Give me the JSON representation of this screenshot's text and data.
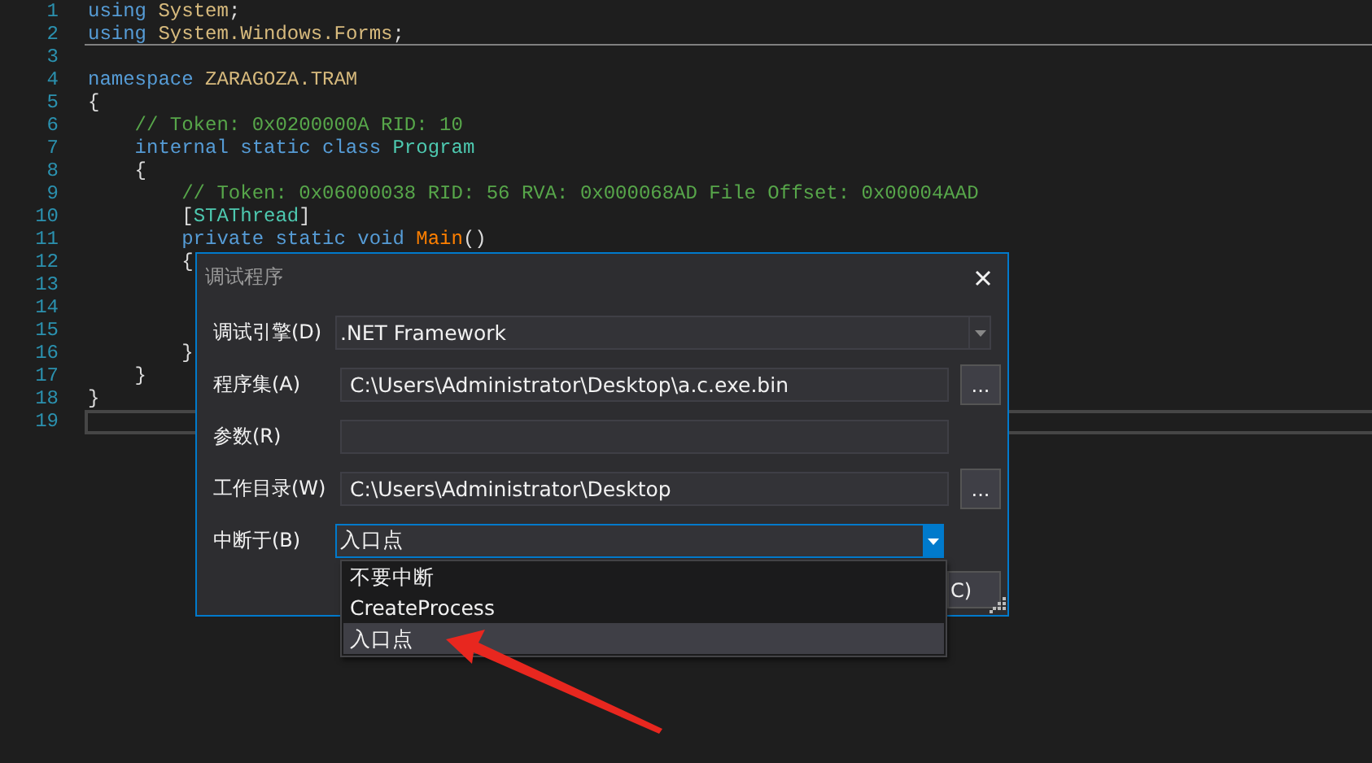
{
  "editor": {
    "lines": [
      {
        "number": "1",
        "current": false,
        "underlined": false,
        "tokens": [
          {
            "kind": "keyword",
            "text": "using "
          },
          {
            "kind": "namespace",
            "text": "System"
          },
          {
            "kind": "plain",
            "text": ";"
          }
        ]
      },
      {
        "number": "2",
        "current": false,
        "underlined": true,
        "tokens": [
          {
            "kind": "keyword",
            "text": "using "
          },
          {
            "kind": "namespace",
            "text": "System.Windows.Forms"
          },
          {
            "kind": "plain",
            "text": ";"
          }
        ]
      },
      {
        "number": "3",
        "current": false,
        "underlined": false
      },
      {
        "number": "4",
        "current": false,
        "underlined": false,
        "tokens": [
          {
            "kind": "keyword",
            "text": "namespace "
          },
          {
            "kind": "namespace",
            "text": "ZARAGOZA.TRAM"
          }
        ]
      },
      {
        "number": "5",
        "current": false,
        "underlined": false,
        "tokens": [
          {
            "kind": "plain",
            "text": "{"
          }
        ]
      },
      {
        "number": "6",
        "current": false,
        "underlined": false,
        "tokens": [
          {
            "kind": "comment",
            "text": "    // Token: 0x0200000A RID: 10"
          }
        ]
      },
      {
        "number": "7",
        "current": false,
        "underlined": false,
        "tokens": [
          {
            "kind": "keyword",
            "text": "    internal static class "
          },
          {
            "kind": "type",
            "text": "Program"
          }
        ]
      },
      {
        "number": "8",
        "current": false,
        "underlined": false,
        "tokens": [
          {
            "kind": "plain",
            "text": "    {"
          }
        ]
      },
      {
        "number": "9",
        "current": false,
        "underlined": false,
        "tokens": [
          {
            "kind": "comment",
            "text": "        // Token: 0x06000038 RID: 56 RVA: 0x000068AD File Offset: 0x00004AAD"
          }
        ]
      },
      {
        "number": "10",
        "current": false,
        "underlined": false,
        "tokens": [
          {
            "kind": "plain",
            "text": "        ["
          },
          {
            "kind": "type",
            "text": "STAThread"
          },
          {
            "kind": "plain",
            "text": "]"
          }
        ]
      },
      {
        "number": "11",
        "current": false,
        "underlined": false,
        "tokens": [
          {
            "kind": "keyword",
            "text": "        private static void "
          },
          {
            "kind": "method",
            "text": "Main"
          },
          {
            "kind": "plain",
            "text": "()"
          }
        ]
      },
      {
        "number": "12",
        "current": false,
        "underlined": false,
        "tokens": [
          {
            "kind": "plain",
            "text": "        {"
          }
        ]
      },
      {
        "number": "13",
        "current": false,
        "underlined": false
      },
      {
        "number": "14",
        "current": false,
        "underlined": false
      },
      {
        "number": "15",
        "current": false,
        "underlined": false
      },
      {
        "number": "16",
        "current": false,
        "underlined": false,
        "tokens": [
          {
            "kind": "plain",
            "text": "        }"
          }
        ]
      },
      {
        "number": "17",
        "current": false,
        "underlined": false,
        "tokens": [
          {
            "kind": "plain",
            "text": "    }"
          }
        ]
      },
      {
        "number": "18",
        "current": false,
        "underlined": false,
        "tokens": [
          {
            "kind": "plain",
            "text": "}"
          }
        ]
      },
      {
        "number": "19",
        "current": true,
        "underlined": false
      }
    ]
  },
  "dialog": {
    "title": "调试程序",
    "fields": [
      {
        "kind": "combo",
        "label": "调试引擎(D)",
        "value": ".NET Framework",
        "focused": false
      },
      {
        "kind": "text",
        "label": "程序集(A)",
        "value": "C:\\Users\\Administrator\\Desktop\\a.c.exe.bin",
        "browse_button": "..."
      },
      {
        "kind": "text",
        "label": "参数(R)"
      },
      {
        "kind": "text",
        "label": "工作目录(W)",
        "value": "C:\\Users\\Administrator\\Desktop",
        "browse_button": "..."
      },
      {
        "kind": "combo",
        "label": "中断于(B)",
        "value": "入口点",
        "focused": true
      }
    ],
    "cancel_button": "C)",
    "dropdown": {
      "items": [
        {
          "label": "不要中断",
          "selected": false
        },
        {
          "label": "CreateProcess",
          "selected": false
        },
        {
          "label": "入口点",
          "selected": true
        }
      ]
    }
  }
}
